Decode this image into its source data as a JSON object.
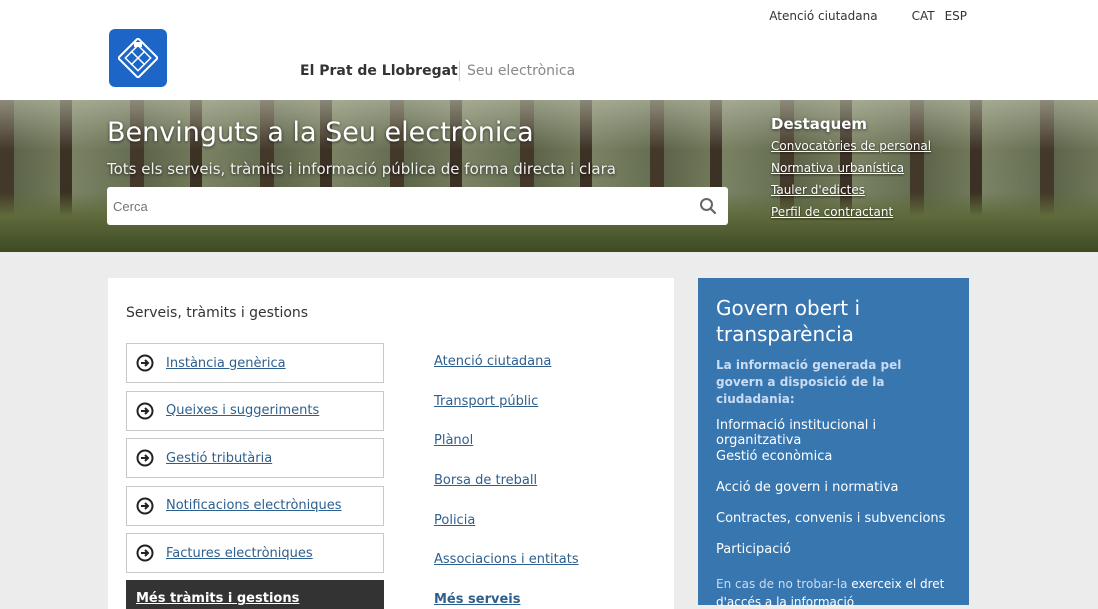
{
  "header": {
    "top_links": {
      "atencio": "Atenció ciutadana",
      "cat": "CAT",
      "esp": "ESP"
    },
    "site_title": "El Prat de Llobregat",
    "site_subtitle": "Seu electrònica",
    "logo_icon": "coat-of-arms-icon",
    "brand_color": "#1d66c7"
  },
  "hero": {
    "title": "Benvinguts a la Seu electrònica",
    "subtitle": "Tots els serveis, tràmits i informació pública de forma directa i clara",
    "search_placeholder": "Cerca",
    "destaquem": {
      "heading": "Destaquem",
      "links": [
        "Convocatòries de personal",
        "Normativa urbanística",
        "Tauler d'edictes",
        "Perfil de contractant"
      ]
    }
  },
  "services": {
    "heading": "Serveis, tràmits i gestions",
    "items": [
      "Instància genèrica",
      "Queixes i suggeriments",
      "Gestió tributària",
      "Notificacions electròniques",
      "Factures electròniques"
    ],
    "more_button": "Més tràmits i gestions",
    "links": [
      "Atenció ciutadana",
      "Transport públic",
      "Plànol",
      "Borsa de treball",
      "Policia",
      "Associacions i entitats"
    ],
    "more_link": "Més serveis"
  },
  "transparency": {
    "heading": "Govern obert i transparència",
    "lead": "La informació generada pel govern a disposició de la ciudadania:",
    "links": [
      "Informació institucional i organitzativa",
      "Gestió econòmica",
      "Acció de govern i normativa",
      "Contractes, convenis i subvencions",
      "Participació"
    ],
    "note_prefix": "En cas de no trobar-la",
    "note_link": "exerceix el dret d'accés a la informació",
    "panel_color": "#3876b0"
  }
}
